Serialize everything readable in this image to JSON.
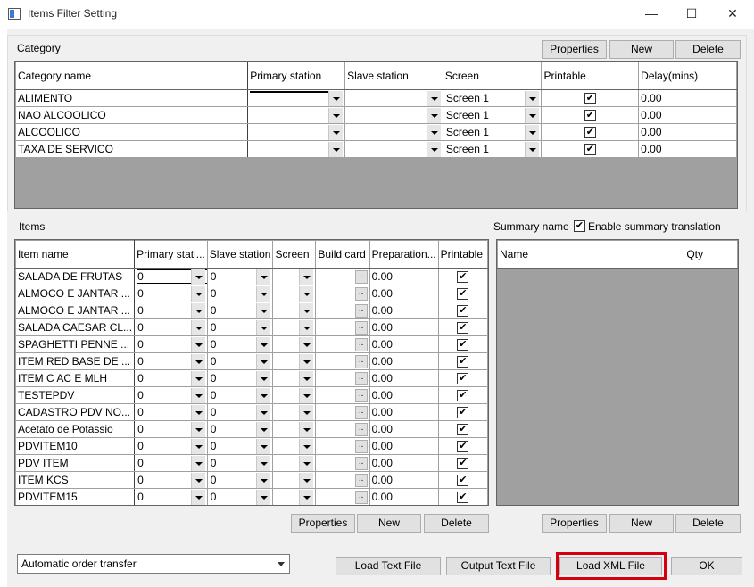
{
  "window": {
    "title": "Items Filter Setting",
    "min_icon": "minimize-icon",
    "max_icon": "maximize-icon",
    "close_icon": "close-icon"
  },
  "category": {
    "label": "Category",
    "buttons": {
      "properties": "Properties",
      "new": "New",
      "delete": "Delete"
    },
    "columns": [
      "Category name",
      "Primary station",
      "Slave station",
      "Screen",
      "Printable",
      "Delay(mins)"
    ],
    "rows": [
      {
        "name": "ALIMENTO",
        "primary": "",
        "slave": "",
        "screen": "Screen 1",
        "printable": true,
        "delay": "0.00"
      },
      {
        "name": "NAO ALCOOLICO",
        "primary": "",
        "slave": "",
        "screen": "Screen 1",
        "printable": true,
        "delay": "0.00"
      },
      {
        "name": "ALCOOLICO",
        "primary": "",
        "slave": "",
        "screen": "Screen 1",
        "printable": true,
        "delay": "0.00"
      },
      {
        "name": "TAXA DE SERVICO",
        "primary": "",
        "slave": "",
        "screen": "Screen 1",
        "printable": true,
        "delay": "0.00"
      }
    ]
  },
  "items": {
    "label": "Items",
    "buttons": {
      "properties": "Properties",
      "new": "New",
      "delete": "Delete"
    },
    "columns": [
      "Item name",
      "Primary stati...",
      "Slave station",
      "Screen",
      "Build card",
      "Preparation...",
      "Printable"
    ],
    "rows": [
      {
        "name": "SALADA DE FRUTAS",
        "primary": "0",
        "slave": "0",
        "screen": "",
        "build": "..",
        "prep": "0.00",
        "printable": true
      },
      {
        "name": "ALMOCO E JANTAR ...",
        "primary": "0",
        "slave": "0",
        "screen": "",
        "build": "..",
        "prep": "0.00",
        "printable": true
      },
      {
        "name": "ALMOCO E JANTAR ...",
        "primary": "0",
        "slave": "0",
        "screen": "",
        "build": "..",
        "prep": "0.00",
        "printable": true
      },
      {
        "name": "SALADA CAESAR CL...",
        "primary": "0",
        "slave": "0",
        "screen": "",
        "build": "..",
        "prep": "0.00",
        "printable": true
      },
      {
        "name": "SPAGHETTI PENNE ...",
        "primary": "0",
        "slave": "0",
        "screen": "",
        "build": "..",
        "prep": "0.00",
        "printable": true
      },
      {
        "name": "ITEM RED BASE DE ...",
        "primary": "0",
        "slave": "0",
        "screen": "",
        "build": "..",
        "prep": "0.00",
        "printable": true
      },
      {
        "name": "ITEM C AC E MLH",
        "primary": "0",
        "slave": "0",
        "screen": "",
        "build": "..",
        "prep": "0.00",
        "printable": true
      },
      {
        "name": "TESTEPDV",
        "primary": "0",
        "slave": "0",
        "screen": "",
        "build": "..",
        "prep": "0.00",
        "printable": true
      },
      {
        "name": "CADASTRO PDV NO...",
        "primary": "0",
        "slave": "0",
        "screen": "",
        "build": "..",
        "prep": "0.00",
        "printable": true
      },
      {
        "name": "Acetato de Potassio",
        "primary": "0",
        "slave": "0",
        "screen": "",
        "build": "..",
        "prep": "0.00",
        "printable": true
      },
      {
        "name": "PDVITEM10",
        "primary": "0",
        "slave": "0",
        "screen": "",
        "build": "..",
        "prep": "0.00",
        "printable": true
      },
      {
        "name": "PDV ITEM",
        "primary": "0",
        "slave": "0",
        "screen": "",
        "build": "..",
        "prep": "0.00",
        "printable": true
      },
      {
        "name": "ITEM KCS",
        "primary": "0",
        "slave": "0",
        "screen": "",
        "build": "..",
        "prep": "0.00",
        "printable": true
      },
      {
        "name": "PDVITEM15",
        "primary": "0",
        "slave": "0",
        "screen": "",
        "build": "..",
        "prep": "0.00",
        "printable": true
      }
    ]
  },
  "summary": {
    "label": "Summary name",
    "enable_label": "Enable summary translation",
    "enabled": true,
    "columns": [
      "Name",
      "Qty"
    ],
    "buttons": {
      "properties": "Properties",
      "new": "New",
      "delete": "Delete"
    }
  },
  "footer": {
    "transfer_mode": "Automatic order transfer",
    "load_text": "Load Text File",
    "output_text": "Output Text File",
    "load_xml": "Load XML File",
    "ok": "OK",
    "highlight_color": "#d4000e"
  }
}
